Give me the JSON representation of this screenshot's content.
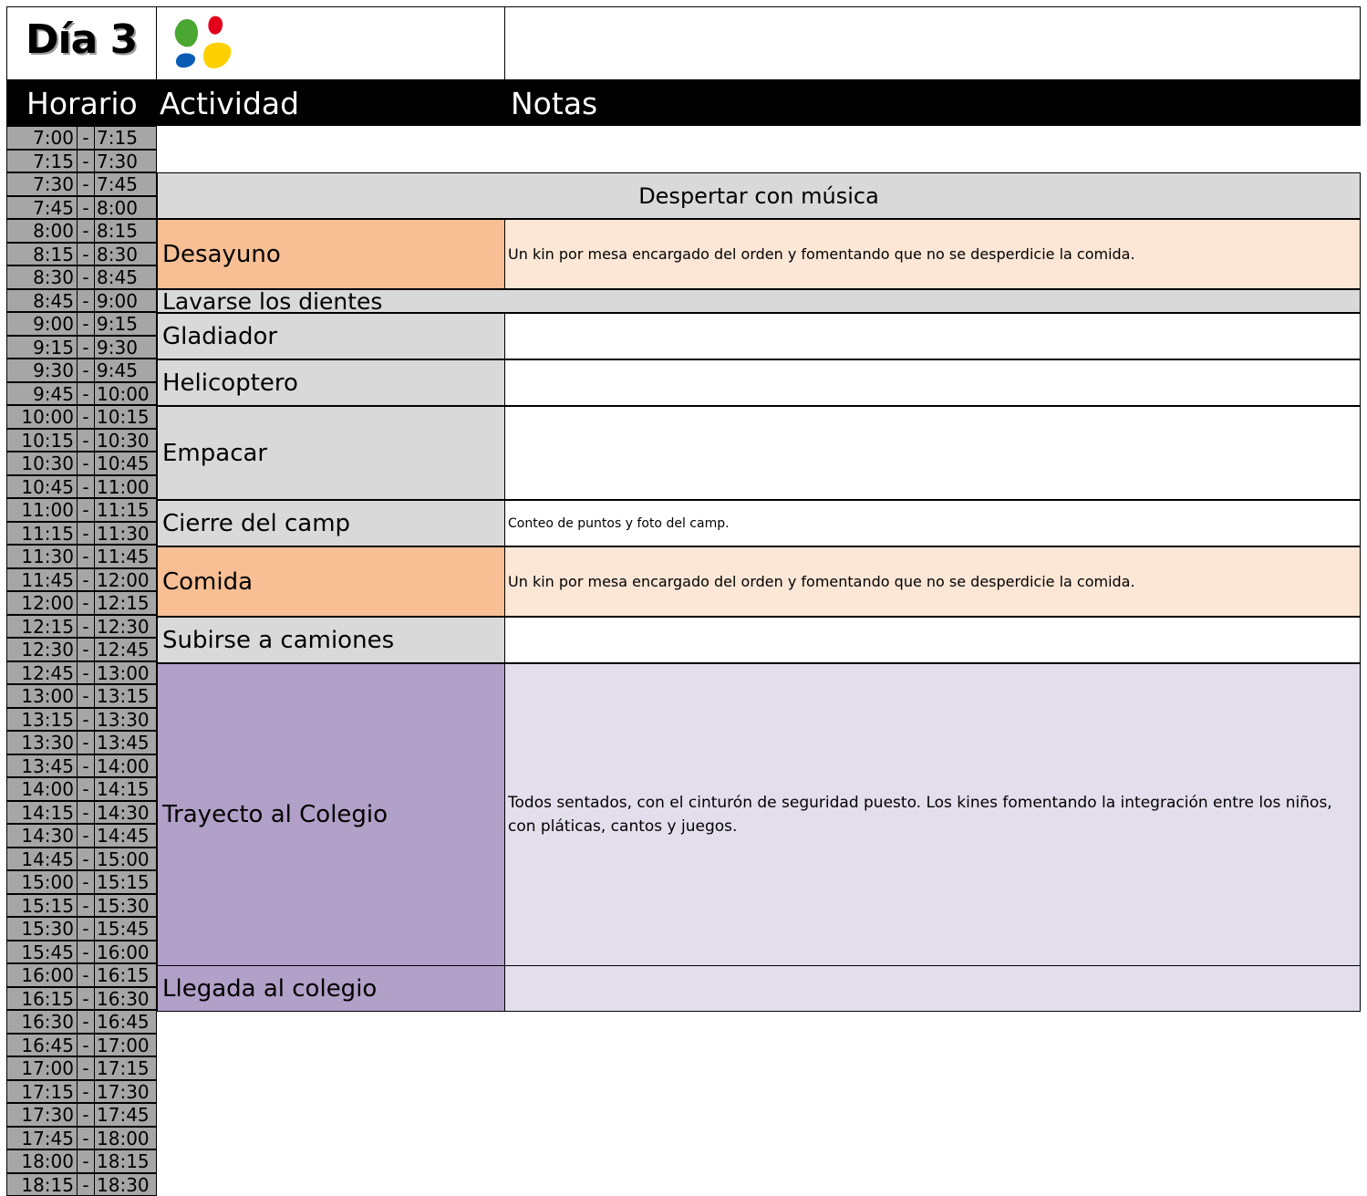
{
  "header": {
    "day_title": "Día 3",
    "col_time": "Horario",
    "col_activity": "Actividad",
    "col_notes": "Notas"
  },
  "logo": {
    "icon": "four-petal-colored-logo-icon",
    "colors": [
      "#e2001a",
      "#4aa832",
      "#0a5cb4",
      "#ffd000"
    ]
  },
  "colors": {
    "time_bg": "#a6a6a6",
    "gray_bg": "#d9d9d9",
    "orange_bg": "#f8bf94",
    "orange_light_bg": "#fce6d5",
    "purple_bg": "#b1a0c7",
    "purple_light_bg": "#e3deec",
    "header_bg": "#000000"
  },
  "times": [
    [
      "7:00",
      "-",
      "7:15"
    ],
    [
      "7:15",
      "-",
      "7:30"
    ],
    [
      "7:30",
      "-",
      "7:45"
    ],
    [
      "7:45",
      "-",
      "8:00"
    ],
    [
      "8:00",
      "-",
      "8:15"
    ],
    [
      "8:15",
      "-",
      "8:30"
    ],
    [
      "8:30",
      "-",
      "8:45"
    ],
    [
      "8:45",
      "-",
      "9:00"
    ],
    [
      "9:00",
      "-",
      "9:15"
    ],
    [
      "9:15",
      "-",
      "9:30"
    ],
    [
      "9:30",
      "-",
      "9:45"
    ],
    [
      "9:45",
      "-",
      "10:00"
    ],
    [
      "10:00",
      "-",
      "10:15"
    ],
    [
      "10:15",
      "-",
      "10:30"
    ],
    [
      "10:30",
      "-",
      "10:45"
    ],
    [
      "10:45",
      "-",
      "11:00"
    ],
    [
      "11:00",
      "-",
      "11:15"
    ],
    [
      "11:15",
      "-",
      "11:30"
    ],
    [
      "11:30",
      "-",
      "11:45"
    ],
    [
      "11:45",
      "-",
      "12:00"
    ],
    [
      "12:00",
      "-",
      "12:15"
    ],
    [
      "12:15",
      "-",
      "12:30"
    ],
    [
      "12:30",
      "-",
      "12:45"
    ],
    [
      "12:45",
      "-",
      "13:00"
    ],
    [
      "13:00",
      "-",
      "13:15"
    ],
    [
      "13:15",
      "-",
      "13:30"
    ],
    [
      "13:30",
      "-",
      "13:45"
    ],
    [
      "13:45",
      "-",
      "14:00"
    ],
    [
      "14:00",
      "-",
      "14:15"
    ],
    [
      "14:15",
      "-",
      "14:30"
    ],
    [
      "14:30",
      "-",
      "14:45"
    ],
    [
      "14:45",
      "-",
      "15:00"
    ],
    [
      "15:00",
      "-",
      "15:15"
    ],
    [
      "15:15",
      "-",
      "15:30"
    ],
    [
      "15:30",
      "-",
      "15:45"
    ],
    [
      "15:45",
      "-",
      "16:00"
    ],
    [
      "16:00",
      "-",
      "16:15"
    ],
    [
      "16:15",
      "-",
      "16:30"
    ],
    [
      "16:30",
      "-",
      "16:45"
    ],
    [
      "16:45",
      "-",
      "17:00"
    ],
    [
      "17:00",
      "-",
      "17:15"
    ],
    [
      "17:15",
      "-",
      "17:30"
    ],
    [
      "17:30",
      "-",
      "17:45"
    ],
    [
      "17:45",
      "-",
      "18:00"
    ],
    [
      "18:00",
      "-",
      "18:15"
    ],
    [
      "18:15",
      "-",
      "18:30"
    ]
  ],
  "schedule": {
    "despertar": "Despertar con música",
    "desayuno": {
      "activity": "Desayuno",
      "note": "Un kin por mesa encargado del orden y fomentando que no se desperdicie la comida."
    },
    "lavarse": "Lavarse los dientes",
    "gladiador": {
      "activity": "Gladiador"
    },
    "helicoptero": {
      "activity": "Helicoptero"
    },
    "empacar": {
      "activity": "Empacar"
    },
    "cierre": {
      "activity": "Cierre del camp",
      "note": "Conteo de puntos y foto del camp."
    },
    "comida": {
      "activity": "Comida",
      "note": "Un kin por mesa encargado del orden y fomentando que no se desperdicie la comida."
    },
    "subirse": {
      "activity": "Subirse a camiones"
    },
    "trayecto": {
      "activity": "Trayecto al Colegio",
      "note": "Todos sentados, con el cinturón de seguridad puesto. Los kines fomentando la integración entre los niños, con pláticas, cantos y juegos."
    },
    "llegada": {
      "activity": "Llegada al colegio"
    }
  }
}
